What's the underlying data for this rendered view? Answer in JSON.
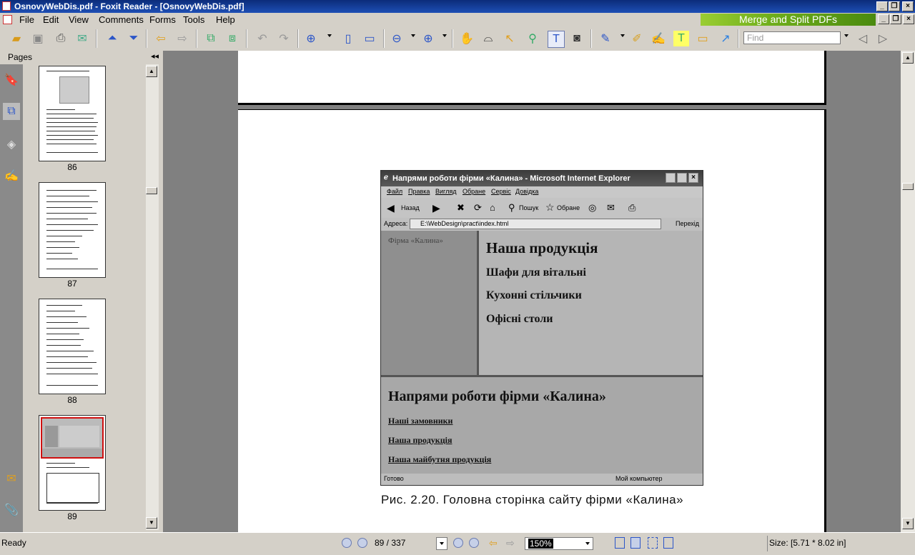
{
  "window": {
    "title": "OsnovyWebDis.pdf - Foxit Reader - [OsnovyWebDis.pdf]",
    "banner": "Merge and Split PDFs"
  },
  "menu": {
    "file": "File",
    "edit": "Edit",
    "view": "View",
    "comments": "Comments",
    "forms": "Forms",
    "tools": "Tools",
    "help": "Help"
  },
  "toolbar": {
    "find_placeholder": "Find"
  },
  "left_panel": {
    "title": "Pages",
    "thumbnails": [
      {
        "page": "86"
      },
      {
        "page": "87"
      },
      {
        "page": "88"
      },
      {
        "page": "89"
      }
    ]
  },
  "figure": {
    "ie_title": "Напрями роботи фірми «Калина» - Microsoft Internet Explorer",
    "ie_menu": [
      "Файл",
      "Правка",
      "Вигляд",
      "Обране",
      "Сервіс",
      "Довідка"
    ],
    "ie_back": "Назад",
    "ie_search": "Пошук",
    "ie_favorites": "Обране",
    "address_label": "Адреса:",
    "address": "E:\\WebDesign\\pract\\index.html",
    "go_label": "Перехід",
    "sidebar_text": "Фірма «Калина»",
    "main_heading": "Наша продукція",
    "main_items": [
      "Шафи для вітальні",
      "Кухонні стільчики",
      "Офісні столи"
    ],
    "bottom_heading": "Напрями роботи фірми «Калина»",
    "bottom_links": [
      "Наші замовники",
      "Наша продукція",
      "Наша майбутня продукція"
    ],
    "status_left": "Готово",
    "status_right": "Мой компьютер"
  },
  "caption": "Рис. 2.20. Головна сторінка сайту фірми «Калина»",
  "statusbar": {
    "ready": "Ready",
    "page_indicator": "89 / 337",
    "zoom": "150%",
    "size": "Size: [5.71 * 8.02 in]"
  }
}
